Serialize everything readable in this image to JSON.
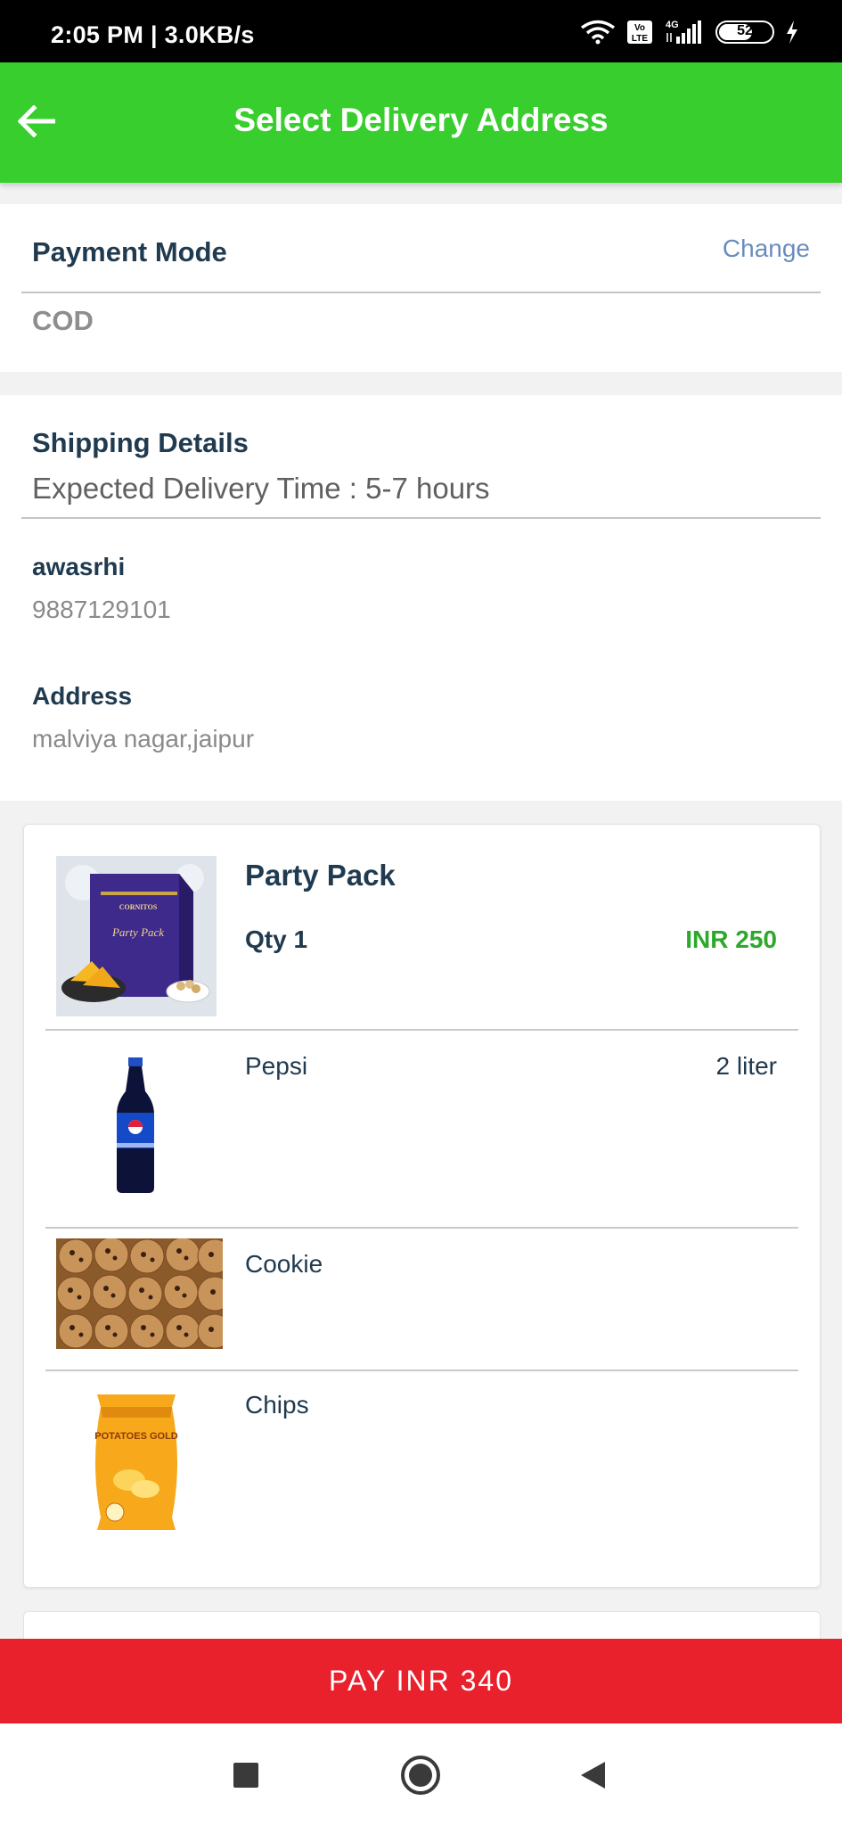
{
  "status_bar": {
    "time": "2:05 PM | 3.0KB/s",
    "volte_label": "Vo LTE",
    "network_label": "4G",
    "battery": "52"
  },
  "app_bar": {
    "title": "Select Delivery Address",
    "back_icon": "arrow-left-icon"
  },
  "payment": {
    "title": "Payment Mode",
    "change_label": "Change",
    "value": "COD"
  },
  "shipping": {
    "title": "Shipping Details",
    "expected": "Expected Delivery Time : 5-7 hours",
    "name": "awasrhi",
    "phone": "9887129101",
    "address_label": "Address",
    "address": "malviya nagar,jaipur"
  },
  "items": [
    {
      "name": "Party Pack",
      "qty": "Qty 1",
      "price": "INR 250",
      "image_label": "CORNITOS",
      "image_sub": "Party Pack"
    },
    {
      "name": "Pepsi",
      "extra": "2 liter"
    },
    {
      "name": "Cookie"
    },
    {
      "name": "Chips",
      "image_label": "POTATOES GOLD"
    }
  ],
  "pay_button": {
    "label": "PAY INR 340"
  },
  "nav": {
    "recents_icon": "square-icon",
    "home_icon": "circle-icon",
    "back_icon": "triangle-back-icon"
  },
  "colors": {
    "app_bar": "#38ce2d",
    "pay_button": "#e8212d",
    "price": "#2ea82c",
    "link": "#6a8cbd"
  }
}
